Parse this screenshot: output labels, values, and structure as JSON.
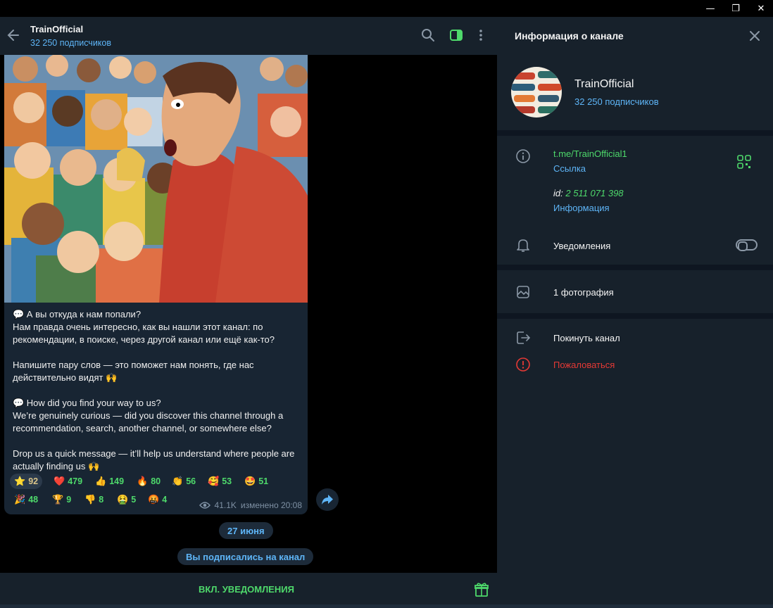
{
  "window": {
    "minimize": "—",
    "maximize": "❐",
    "close": "✕"
  },
  "chat": {
    "title": "TrainOfficial",
    "subscribers": "32 250 подписчиков",
    "message": {
      "text": "💬 А вы откуда к нам попали?\nНам правда очень интересно, как вы нашли этот канал: по рекомендации, в поиске, через другой канал или ещё как-то?\n\nНапишите пару слов — это поможет нам понять, где нас действительно видят 🙌\n\n💬 How did you find your way to us?\nWe’re genuinely curious — did you discover this channel through a recommendation, search, another channel, or somewhere else?\n\nDrop us a quick message — it’ll help us understand where people are actually finding us 🙌",
      "reactions": [
        {
          "emoji": "⭐",
          "count": "92"
        },
        {
          "emoji": "❤️",
          "count": "479"
        },
        {
          "emoji": "👍",
          "count": "149"
        },
        {
          "emoji": "🔥",
          "count": "80"
        },
        {
          "emoji": "👏",
          "count": "56"
        },
        {
          "emoji": "🥰",
          "count": "53"
        },
        {
          "emoji": "🤩",
          "count": "51"
        },
        {
          "emoji": "🎉",
          "count": "48"
        },
        {
          "emoji": "🏆",
          "count": "9"
        },
        {
          "emoji": "👎",
          "count": "8"
        },
        {
          "emoji": "🤮",
          "count": "5"
        },
        {
          "emoji": "🤬",
          "count": "4"
        }
      ],
      "views": "41.1K",
      "edited": "изменено 20:08"
    },
    "date_pill": "27 июня",
    "service_pill": "Вы подписались на канал",
    "notify_button": "ВКЛ. УВЕДОМЛЕНИЯ"
  },
  "panel": {
    "title": "Информация о канале",
    "name": "TrainOfficial",
    "subscribers": "32 250 подписчиков",
    "link": "t.me/TrainOfficial1",
    "link_label": "Ссылка",
    "id_prefix": "id:",
    "id_value": "2 511 071 398",
    "id_label": "Информация",
    "notifications": "Уведомления",
    "photos": "1 фотография",
    "leave": "Покинуть канал",
    "report": "Пожаловаться"
  },
  "colors": {
    "accent_green": "#4ed96b",
    "link_blue": "#5eb5f7",
    "danger_red": "#e53935",
    "panel_bg": "#17212b"
  }
}
